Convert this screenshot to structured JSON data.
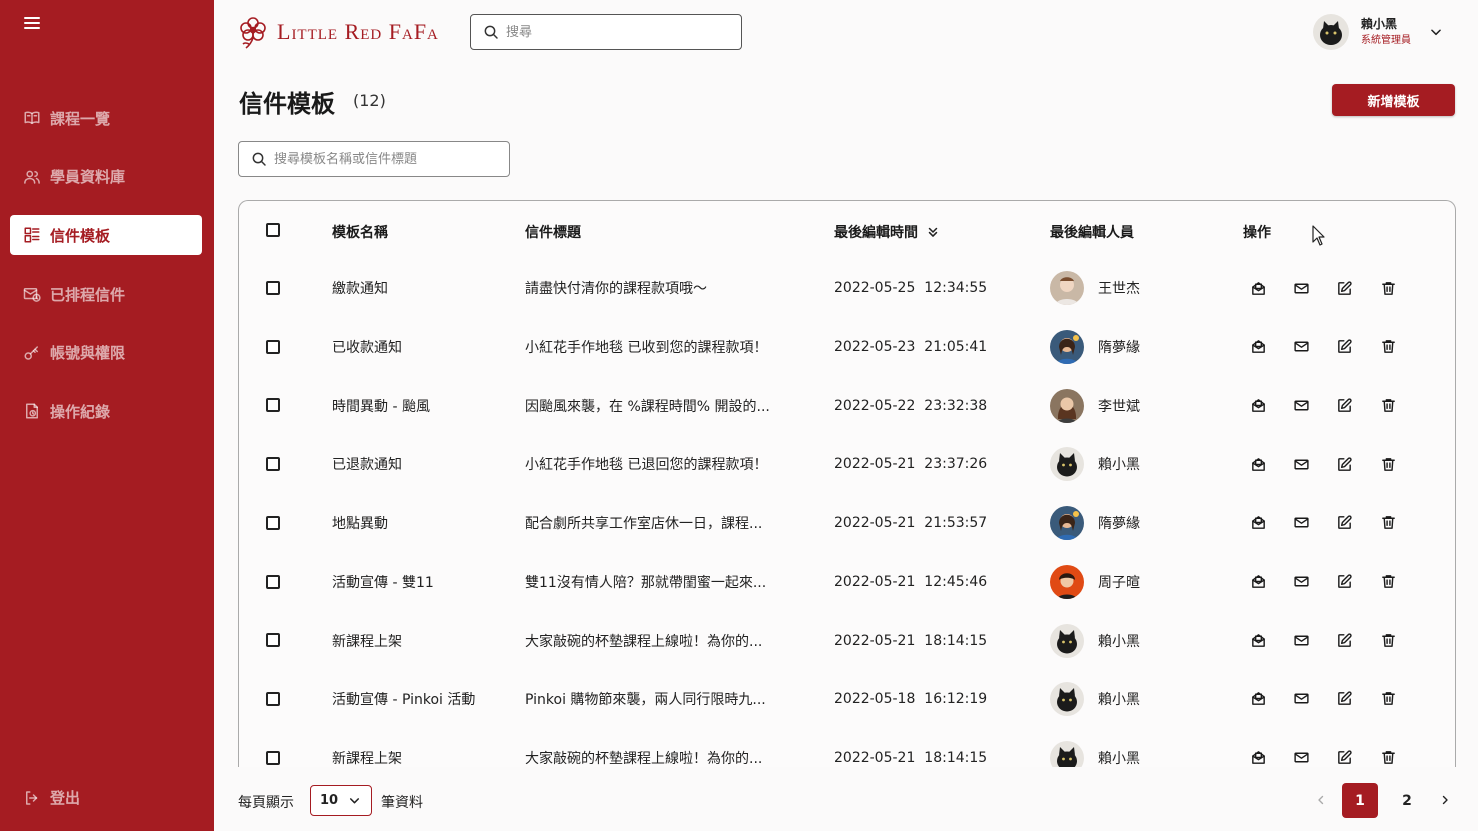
{
  "brand": {
    "name": "Little Red FaFa",
    "color": "#a51c22"
  },
  "sidebar": {
    "items": [
      {
        "label": "課程一覽",
        "icon": "book-icon",
        "active": false
      },
      {
        "label": "學員資料庫",
        "icon": "users-icon",
        "active": false
      },
      {
        "label": "信件模板",
        "icon": "template-icon",
        "active": true
      },
      {
        "label": "已排程信件",
        "icon": "scheduled-mail-icon",
        "active": false
      },
      {
        "label": "帳號與權限",
        "icon": "key-icon",
        "active": false
      },
      {
        "label": "操作紀錄",
        "icon": "log-icon",
        "active": false
      }
    ],
    "logout_label": "登出"
  },
  "header": {
    "search_placeholder": "搜尋",
    "user": {
      "name": "賴小黑",
      "role": "系統管理員"
    }
  },
  "page": {
    "title": "信件模板",
    "count": "(12)",
    "add_button": "新增模板",
    "search_placeholder": "搜尋模板名稱或信件標題"
  },
  "table": {
    "columns": {
      "name": "模板名稱",
      "subject": "信件標題",
      "edited_at": "最後編輯時間",
      "editor": "最後編輯人員",
      "actions": "操作"
    },
    "rows": [
      {
        "name": "繳款通知",
        "subject": "請盡快付清你的課程款項哦～",
        "date": "2022-05-25",
        "time": "12:34:55",
        "editor": "王世杰",
        "avatar": "man"
      },
      {
        "name": "已收款通知",
        "subject": "小紅花手作地毯 已收到您的課程款項！",
        "date": "2022-05-23",
        "time": "21:05:41",
        "editor": "隋夢緣",
        "avatar": "woman-blue"
      },
      {
        "name": "時間異動 - 颱風",
        "subject": "因颱風來襲，在 %課程時間% 開設的...",
        "date": "2022-05-22",
        "time": "23:32:38",
        "editor": "李世斌",
        "avatar": "woman-brown"
      },
      {
        "name": "已退款通知",
        "subject": "小紅花手作地毯 已退回您的課程款項！",
        "date": "2022-05-21",
        "time": "23:37:26",
        "editor": "賴小黑",
        "avatar": "cat"
      },
      {
        "name": "地點異動",
        "subject": "配合劇所共享工作室店休一日，課程...",
        "date": "2022-05-21",
        "time": "21:53:57",
        "editor": "隋夢緣",
        "avatar": "woman-blue"
      },
      {
        "name": "活動宣傳 - 雙11",
        "subject": "雙11沒有情人陪？那就帶閨蜜一起來...",
        "date": "2022-05-21",
        "time": "12:45:46",
        "editor": "周子暄",
        "avatar": "woman-red"
      },
      {
        "name": "新課程上架",
        "subject": "大家敲碗的杯墊課程上線啦！為你的...",
        "date": "2022-05-21",
        "time": "18:14:15",
        "editor": "賴小黑",
        "avatar": "cat"
      },
      {
        "name": "活動宣傳 - Pinkoi 活動",
        "subject": "Pinkoi 購物節來襲，兩人同行限時九...",
        "date": "2022-05-18",
        "time": "16:12:19",
        "editor": "賴小黑",
        "avatar": "cat"
      },
      {
        "name": "新課程上架",
        "subject": "大家敲碗的杯墊課程上線啦！為你的...",
        "date": "2022-05-21",
        "time": "18:14:15",
        "editor": "賴小黑",
        "avatar": "cat"
      }
    ]
  },
  "pagination": {
    "per_page_label": "每頁顯示",
    "per_page_value": "10",
    "per_page_suffix": "筆資料",
    "pages": [
      "1",
      "2"
    ],
    "current_page": "1"
  }
}
